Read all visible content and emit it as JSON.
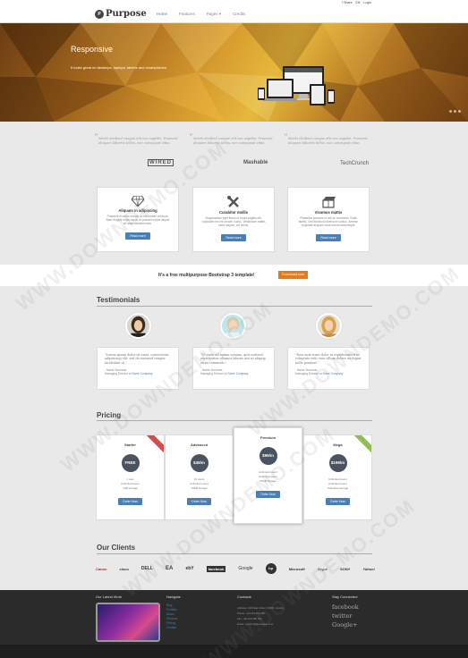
{
  "topbar": {
    "links": [
      "f Share",
      "EN",
      "Login"
    ]
  },
  "brand": {
    "mark": "P",
    "name": "Purpose"
  },
  "nav": {
    "items": [
      "Home",
      "Features",
      "Pages ▾",
      "Credits"
    ],
    "active": "Home"
  },
  "hero": {
    "title": "Responsive",
    "subtitle": "It looks great on desktops, laptops, tablets and smartphones",
    "slides": 3
  },
  "press": [
    {
      "quote": "Morbi eleifend congue elit nec sagittis. Praesent aliquam lobortis tellus, nec consequat vitae.",
      "logo": "WIRED"
    },
    {
      "quote": "Morbi eleifend congue elit nec sagittis. Praesent aliquam lobortis tellus, nec consequat vitae.",
      "logo": "Mashable"
    },
    {
      "quote": "Morbi eleifend congue elit nec sagittis. Praesent aliquam lobortis tellus, nec consequat vitae.",
      "logo": "TechCrunch"
    }
  ],
  "features": [
    {
      "icon": "diamond-icon",
      "title": "Aliquam in adipiscing",
      "text": "Praesent rhoncus mauris ac sollicitudin vehicula. Nam fringilla turpis turpis, at posuere turpis aliquet sit amet condimentum.",
      "button": "Read more"
    },
    {
      "icon": "tools-icon",
      "title": "Curabitur mollis",
      "text": "Suspendisse eget libero ut turpis sagittis elit, vulputate nec elit ornare, luctus. Vestibulum mattis lorem sapien, vel lectus.",
      "button": "Read more"
    },
    {
      "icon": "box-icon",
      "title": "Vivamus mattis",
      "text": "Phasellus posuere et nisl ac commodo. Nulla facilisi. Sed tincidunt bibendum cursus. Aenean vulputate aliquam risus rutrum scelerisque.",
      "button": "Read more"
    }
  ],
  "cta": {
    "text": "It's a free multipurpose Bootstrap 3 template!",
    "button": "Download now"
  },
  "testimonials": {
    "title": "Testimonials",
    "items": [
      {
        "quote": "\"Lorem ipsum dolor sit amet, consectetur adipisicing elit, sed do eiusmod tempor incididunt ut.\"",
        "name": "- Name Surname,",
        "role": "Managing Director at",
        "company": "Some Company"
      },
      {
        "quote": "\"Ut enim ad minim veniam, quis nostrud exercitation ullamco laboris nisi ut aliquip ex ea commodo.\"",
        "name": "- Name Surname,",
        "role": "Managing Director at",
        "company": "Some Company"
      },
      {
        "quote": "\"Duis aute irure dolor in reprehenderit in voluptate velit esse cillum dolore eu fugiat nulla pariatur.\"",
        "name": "- Name Surname,",
        "role": "Managing Director at",
        "company": "Some Company"
      }
    ]
  },
  "pricing": {
    "title": "Pricing",
    "plans": [
      {
        "name": "Starter",
        "price": "FREE",
        "features": [
          "1 user",
          "Unlimited users",
          "1GB storage"
        ],
        "button": "Order Now",
        "ribbon": "red"
      },
      {
        "name": "Advanced",
        "price": "$49/m",
        "features": [
          "10 users",
          "Unlimited users",
          "10GB storage"
        ],
        "button": "Order Now",
        "ribbon": ""
      },
      {
        "name": "Premium",
        "price": "$99/m",
        "features": [
          "Unlimited users",
          "Unlimited users",
          "50GB storage"
        ],
        "button": "Order Now",
        "ribbon": ""
      },
      {
        "name": "Mega",
        "price": "$199/m",
        "features": [
          "Unlimited users",
          "Unlimited users",
          "Unlimited storage"
        ],
        "button": "Order Now",
        "ribbon": "green"
      }
    ]
  },
  "clients": {
    "title": "Our Clients",
    "logos": [
      "Canon",
      "cisco",
      "DELL",
      "EA",
      "ebY",
      "facebook",
      "Google",
      "hp",
      "Microsoft",
      "Skype",
      "SONY",
      "Yahoo!"
    ]
  },
  "footer": {
    "latest_work": "Our Latest Work",
    "navigate": {
      "title": "Navigate",
      "links": [
        "Blog",
        "Portfolio",
        "About",
        "Services",
        "Pricing",
        "Contact"
      ]
    },
    "contacts": {
      "title": "Contacts",
      "lines": [
        "Address: 123 Fake Street, 00000, Country",
        "Phone: +00 123 456 789",
        "Fax: +00 123 456 789",
        "Email: youremail@example.com"
      ]
    },
    "connect": {
      "title": "Stay Connected",
      "networks": [
        "facebook",
        "twitter",
        "Google+"
      ]
    }
  },
  "watermark": "WWW.DOWNDEMO.COM",
  "colors": {
    "accent": "#4a7fb5",
    "cta": "#e47b1f",
    "footer": "#2b2b2b"
  }
}
